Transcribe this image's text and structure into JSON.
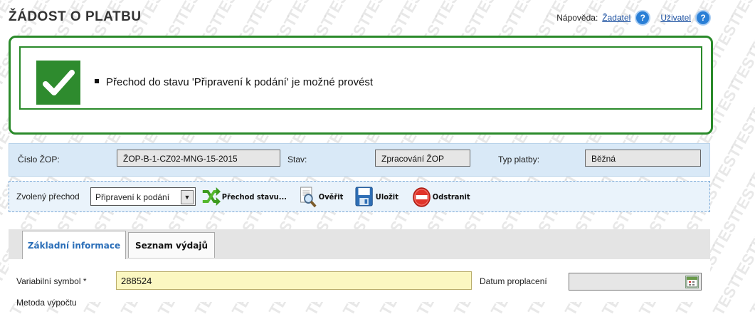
{
  "page": {
    "title": "ŽÁDOST O PLATBU",
    "watermark": "TEST"
  },
  "help": {
    "label": "Nápověda:",
    "links": [
      {
        "text": "Žadatel",
        "icon": "help-question-icon"
      },
      {
        "text": "Uživatel",
        "icon": "help-question-icon"
      }
    ]
  },
  "message": {
    "icon": "checkmark-icon",
    "text": "Přechod do stavu 'Připravení k podání' je možné provést"
  },
  "info": {
    "zop_label": "Číslo ŽOP:",
    "zop_value": "ŽOP-B-1-CZ02-MNG-15-2015",
    "stav_label": "Stav:",
    "stav_value": "Zpracování ŽOP",
    "typ_label": "Typ platby:",
    "typ_value": "Běžná"
  },
  "actions": {
    "transition_label": "Zvolený přechod",
    "transition_selected": "Připravení k podání",
    "buttons": [
      {
        "label": "Přechod stavu...",
        "icon": "shuffle-arrows-icon"
      },
      {
        "label": "Ověřit",
        "icon": "magnifier-document-icon"
      },
      {
        "label": "Uložit",
        "icon": "floppy-disk-icon"
      },
      {
        "label": "Odstranit",
        "icon": "delete-circle-icon"
      }
    ]
  },
  "tabs": [
    {
      "label": "Základní informace",
      "active": true
    },
    {
      "label": "Seznam výdajů",
      "active": false
    }
  ],
  "form": {
    "variable_symbol_label": "Variabilní symbol *",
    "variable_symbol_value": "288524",
    "date_label": "Datum proplacení",
    "date_value": "",
    "next_label": "Metoda výpočtu"
  },
  "colors": {
    "success": "#2e8b2e",
    "info_bg": "#d9e9f7",
    "required_field_bg": "#fbf7c1",
    "link": "#1a4fa0",
    "tab_active_text": "#2a6eb8"
  }
}
